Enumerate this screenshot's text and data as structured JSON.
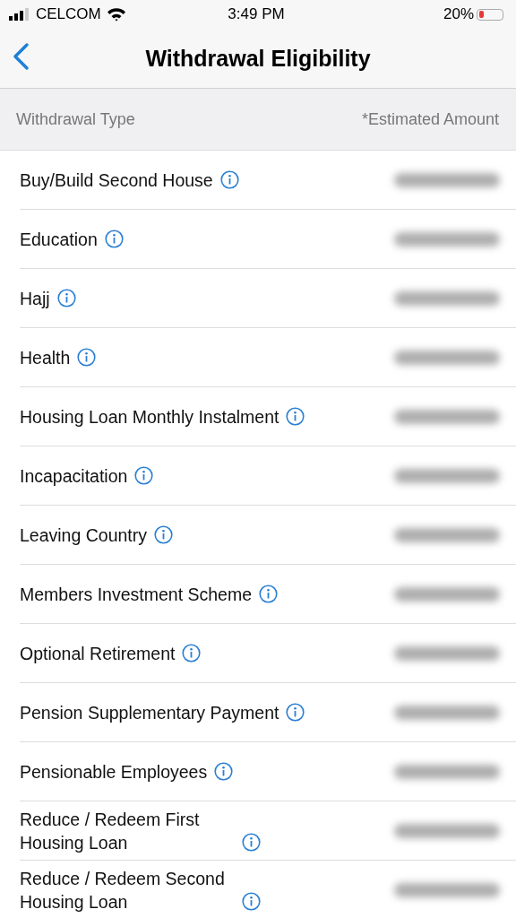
{
  "status_bar": {
    "carrier": "CELCOM",
    "time": "3:49 PM",
    "battery": "20%"
  },
  "nav": {
    "title": "Withdrawal Eligibility"
  },
  "table": {
    "columns": [
      "Withdrawal Type",
      "*Estimated Amount"
    ],
    "rows": [
      {
        "label": "Buy/Build Second House",
        "amount_blurred": true
      },
      {
        "label": "Education",
        "amount_blurred": true
      },
      {
        "label": "Hajj",
        "amount_blurred": true
      },
      {
        "label": "Health",
        "amount_blurred": true
      },
      {
        "label": "Housing Loan Monthly Instalment",
        "amount_blurred": true
      },
      {
        "label": "Incapacitation",
        "amount_blurred": true
      },
      {
        "label": "Leaving Country",
        "amount_blurred": true
      },
      {
        "label": "Members Investment Scheme",
        "amount_blurred": true
      },
      {
        "label": "Optional Retirement",
        "amount_blurred": true
      },
      {
        "label": "Pension Supplementary Payment",
        "amount_blurred": true
      },
      {
        "label": "Pensionable Employees",
        "amount_blurred": true
      },
      {
        "label": "Reduce / Redeem First Housing Loan",
        "amount_blurred": true
      },
      {
        "label": "Reduce / Redeem Second Housing Loan",
        "amount_blurred": true
      }
    ]
  }
}
